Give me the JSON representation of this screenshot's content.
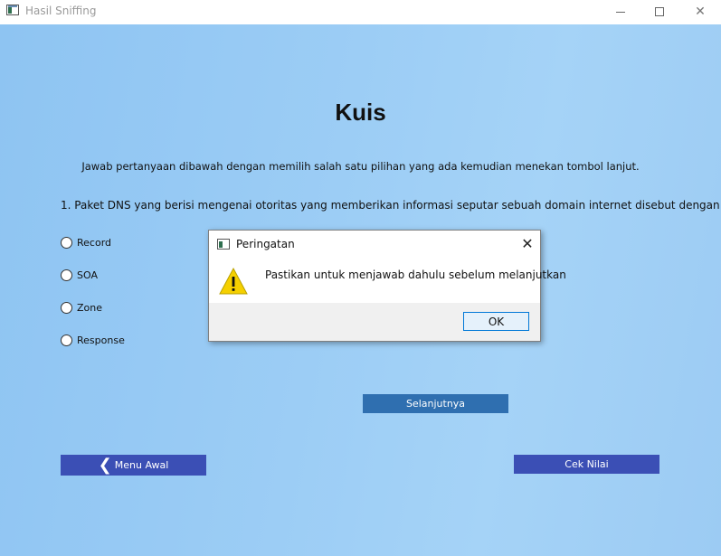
{
  "window": {
    "title": "Hasil Sniffing",
    "minimize_glyph": "",
    "maximize_glyph": "",
    "close_glyph": "✕"
  },
  "quiz": {
    "title": "Kuis",
    "instruction": "Jawab pertanyaan dibawah dengan memilih salah satu pilihan yang ada kemudian menekan tombol lanjut.",
    "question": "1. Paket DNS yang berisi mengenai otoritas yang memberikan informasi seputar sebuah domain internet disebut dengan",
    "options": [
      "Record",
      "SOA",
      "Zone",
      "Response"
    ],
    "next_button": "Selanjutnya",
    "menu_button": "Menu Awal",
    "menu_icon": "❮",
    "score_button": "Cek Nilai"
  },
  "dialog": {
    "title": "Peringatan",
    "close_glyph": "✕",
    "message": "Pastikan untuk menjawab dahulu sebelum melanjutkan",
    "ok_button": "OK",
    "icon": "warning-icon"
  },
  "colors": {
    "background": "#9ccdf5",
    "primary_button": "#3b4fb5",
    "next_button": "#2f6fb0",
    "warning_yellow": "#f5d000"
  }
}
